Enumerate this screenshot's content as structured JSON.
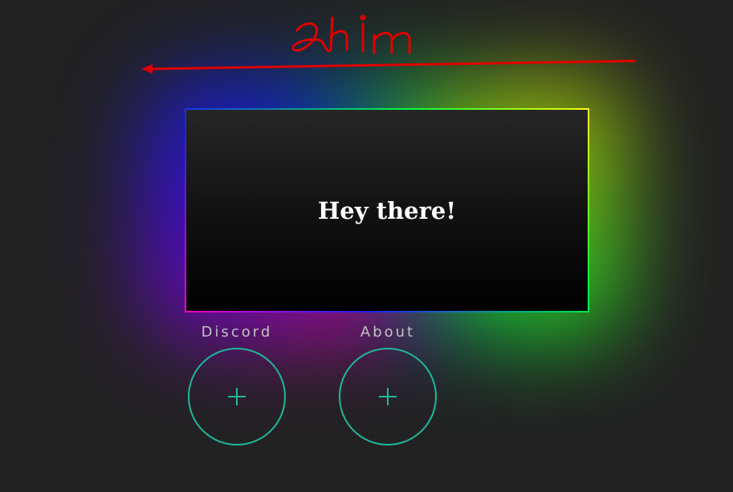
{
  "card": {
    "title": "Hey there!"
  },
  "links": [
    {
      "label": "Discord",
      "icon": "plus-icon"
    },
    {
      "label": "About",
      "icon": "plus-icon"
    }
  ],
  "annotation": {
    "text": "ahim",
    "color": "#e00000"
  },
  "colors": {
    "background": "#222222",
    "accent": "#1fb89a",
    "label_text": "#c2c2c2"
  }
}
